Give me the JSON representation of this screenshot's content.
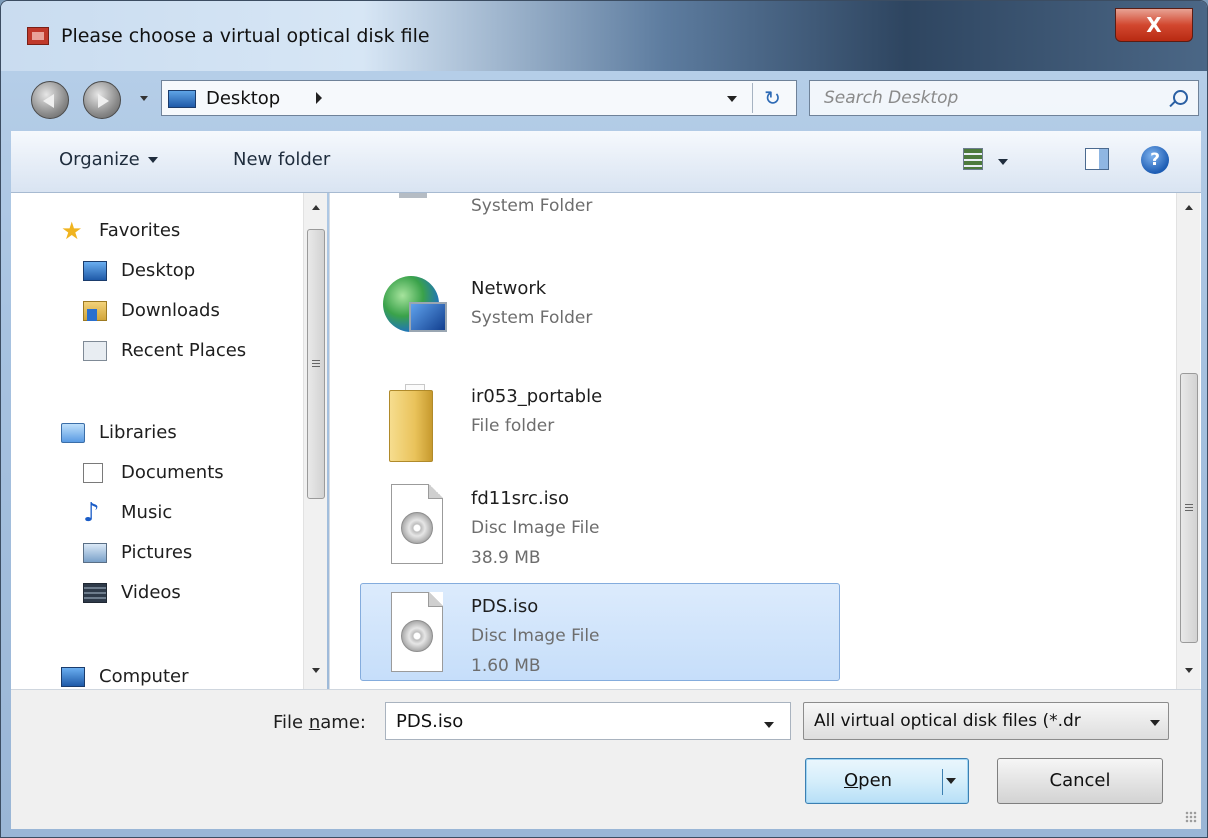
{
  "window": {
    "title": "Please choose a virtual optical disk file",
    "close_glyph": "X"
  },
  "navbar": {
    "address": "Desktop",
    "search_placeholder": "Search Desktop",
    "refresh_glyph": "↻"
  },
  "toolbar": {
    "organize": "Organize",
    "new_folder": "New folder",
    "help_glyph": "?"
  },
  "sidebar": {
    "favorites": {
      "label": "Favorites",
      "items": [
        "Desktop",
        "Downloads",
        "Recent Places"
      ]
    },
    "libraries": {
      "label": "Libraries",
      "items": [
        "Documents",
        "Music",
        "Pictures",
        "Videos"
      ]
    },
    "computer": "Computer"
  },
  "files": [
    {
      "name": "",
      "type": "System Folder",
      "size": "",
      "icon": "computer-icon"
    },
    {
      "name": "Network",
      "type": "System Folder",
      "size": "",
      "icon": "network-icon"
    },
    {
      "name": "ir053_portable",
      "type": "File folder",
      "size": "",
      "icon": "folder-icon"
    },
    {
      "name": "fd11src.iso",
      "type": "Disc Image File",
      "size": "38.9 MB",
      "icon": "disc-image-icon"
    },
    {
      "name": "PDS.iso",
      "type": "Disc Image File",
      "size": "1.60 MB",
      "icon": "disc-image-icon",
      "selected": true
    }
  ],
  "bottom": {
    "file_name_label_pre": "File ",
    "file_name_label_underline": "n",
    "file_name_label_post": "ame:",
    "file_name_value": "PDS.iso",
    "filter": "All virtual optical disk files (*.dr",
    "open_underline": "O",
    "open_rest": "pen",
    "cancel": "Cancel"
  },
  "colors": {
    "selection": "#cce4fb",
    "close_button": "#c8391f",
    "accent": "#3c7fb1"
  }
}
